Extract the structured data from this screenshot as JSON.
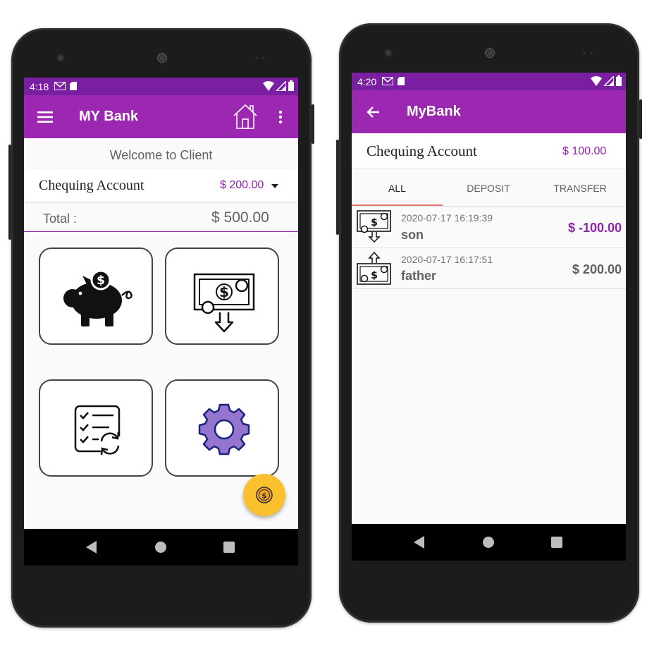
{
  "phone_left": {
    "status": {
      "time": "4:18"
    },
    "toolbar": {
      "title": "MY Bank",
      "menu_icon": "menu-icon",
      "home_icon": "home-icon",
      "more_icon": "more-vert-icon"
    },
    "welcome": "Welcome to Client",
    "account": {
      "name": "Chequing Account",
      "balance": "$ 200.00"
    },
    "total": {
      "label": "Total :",
      "value": "$ 500.00"
    },
    "tiles": [
      {
        "icon": "piggy-bank-icon"
      },
      {
        "icon": "cash-withdraw-icon"
      },
      {
        "icon": "checklist-refresh-icon"
      },
      {
        "icon": "settings-gear-icon"
      }
    ],
    "fab_icon": "coin-icon"
  },
  "phone_right": {
    "status": {
      "time": "4:20"
    },
    "toolbar": {
      "title": "MyBank",
      "back_icon": "arrow-back-icon"
    },
    "account": {
      "name": "Chequing Account",
      "balance": "$ 100.00"
    },
    "tabs": [
      {
        "label": "ALL",
        "active": true
      },
      {
        "label": "DEPOSIT",
        "active": false
      },
      {
        "label": "TRANSFER",
        "active": false
      }
    ],
    "transactions": [
      {
        "date": "2020-07-17 16:19:39",
        "name": "son",
        "amount": "$ -100.00",
        "direction": "out"
      },
      {
        "date": "2020-07-17 16:17:51",
        "name": "father",
        "amount": "$ 200.00",
        "direction": "in"
      }
    ]
  },
  "colors": {
    "status_bar": "#7b1fa2",
    "toolbar": "#9c27b0",
    "accent": "#8e24aa",
    "tab_indicator": "#e57373",
    "fab": "#fbc02d",
    "gear": "#9575cd"
  }
}
